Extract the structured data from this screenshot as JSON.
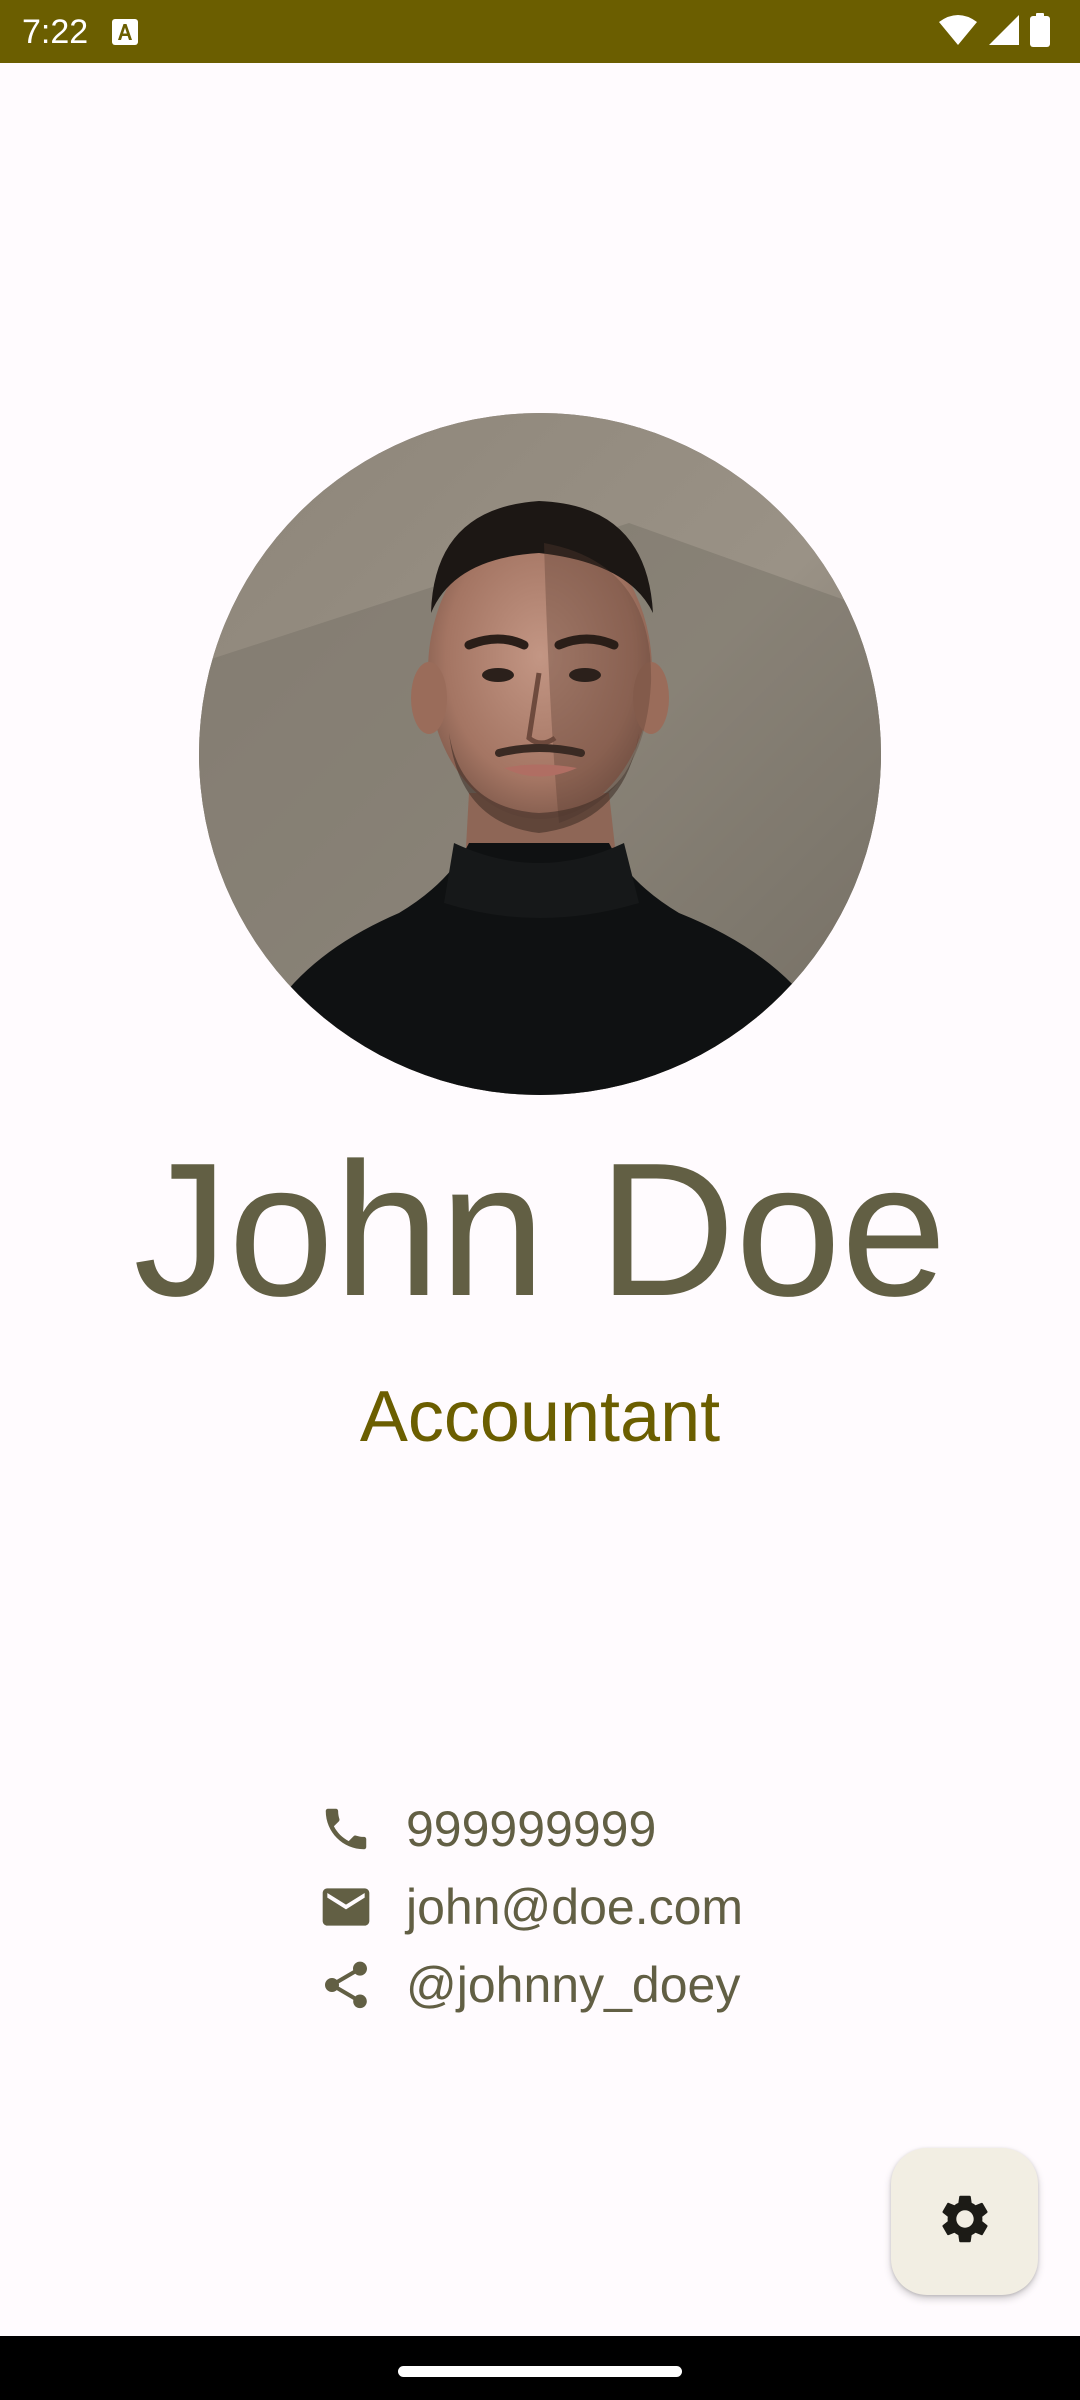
{
  "status_bar": {
    "time": "7:22",
    "background_color": "#6b5e00",
    "icons": [
      "text-a-icon",
      "wifi-icon",
      "cellular-signal-icon",
      "battery-icon"
    ]
  },
  "profile": {
    "name": "John Doe",
    "title": "Accountant",
    "avatar_alt": "profile-photo"
  },
  "contacts": [
    {
      "icon": "phone-icon",
      "text": "999999999"
    },
    {
      "icon": "email-icon",
      "text": "john@doe.com"
    },
    {
      "icon": "share-icon",
      "text": "@johnny_doey"
    }
  ],
  "fab": {
    "icon": "settings-gear-icon"
  },
  "colors": {
    "primary": "#6b5e00",
    "on_surface_variant": "#625f44",
    "background": "#fffbfe",
    "fab_container": "#f2eee3"
  }
}
